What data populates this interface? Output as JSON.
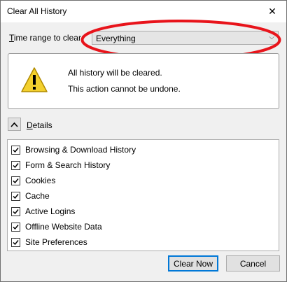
{
  "window": {
    "title": "Clear All History",
    "close_glyph": "✕"
  },
  "range": {
    "label": "Time range to clear:",
    "label_underline_char": "T",
    "label_rest": "ime range to clear:",
    "value": "Everything",
    "arrow": "⌵"
  },
  "warning": {
    "line1": "All history will be cleared.",
    "line2": "This action cannot be undone."
  },
  "details": {
    "label_underline_char": "D",
    "label_rest": "etails",
    "toggle_glyph": "⌃"
  },
  "items": [
    {
      "label": "Browsing & Download History",
      "checked": true
    },
    {
      "label": "Form & Search History",
      "checked": true
    },
    {
      "label": "Cookies",
      "checked": true
    },
    {
      "label": "Cache",
      "checked": true
    },
    {
      "label": "Active Logins",
      "checked": true
    },
    {
      "label": "Offline Website Data",
      "checked": true
    },
    {
      "label": "Site Preferences",
      "checked": true
    }
  ],
  "buttons": {
    "clear_now": "Clear Now",
    "cancel": "Cancel"
  },
  "colors": {
    "highlight": "#e8141b",
    "warning_yellow": "#f3d02e",
    "accent": "#0078d7"
  }
}
